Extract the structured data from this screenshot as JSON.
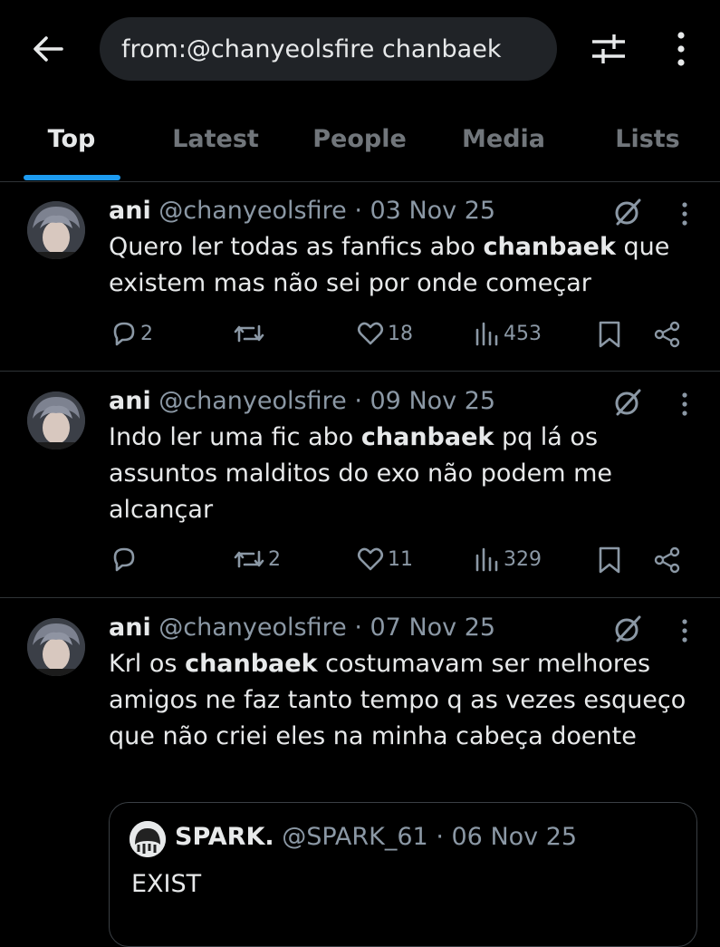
{
  "header": {
    "search_value": "from:@chanyeolsfire chanbaek",
    "back_icon": "arrow-left-icon",
    "filter_icon": "sliders-icon",
    "more_icon": "vertical-dots-icon"
  },
  "tabs": [
    {
      "label": "Top",
      "active": true
    },
    {
      "label": "Latest",
      "active": false
    },
    {
      "label": "People",
      "active": false
    },
    {
      "label": "Media",
      "active": false
    },
    {
      "label": "Lists",
      "active": false
    }
  ],
  "colors": {
    "accent": "#1d9bf0",
    "background": "#000000",
    "muted": "#8b98a5"
  },
  "tweets": [
    {
      "name": "ani",
      "handle": "@chanyeolsfire",
      "sep": "·",
      "date": "03 Nov 25",
      "text_before": "Quero ler todas as fanfics abo ",
      "text_bold": "chanbaek",
      "text_after": " que existem mas não sei por onde começar",
      "replies": "2",
      "reposts": "",
      "likes": "18",
      "views": "453"
    },
    {
      "name": "ani",
      "handle": "@chanyeolsfire",
      "sep": "·",
      "date": "09 Nov 25",
      "text_before": "Indo ler uma fic abo ",
      "text_bold": "chanbaek",
      "text_after": " pq lá os assuntos malditos do exo não podem me alcançar",
      "replies": "",
      "reposts": "2",
      "likes": "11",
      "views": "329"
    },
    {
      "name": "ani",
      "handle": "@chanyeolsfire",
      "sep": "·",
      "date": "07 Nov 25",
      "text_before": "Krl os ",
      "text_bold": "chanbaek",
      "text_after": " costumavam ser melhores amigos ne faz tanto tempo q as vezes esqueço que não criei eles na minha cabeça doente",
      "quote": {
        "name": "SPARK.",
        "handle": "@SPARK_61",
        "sep": "·",
        "date": "06 Nov 25",
        "text": "EXIST"
      }
    }
  ]
}
